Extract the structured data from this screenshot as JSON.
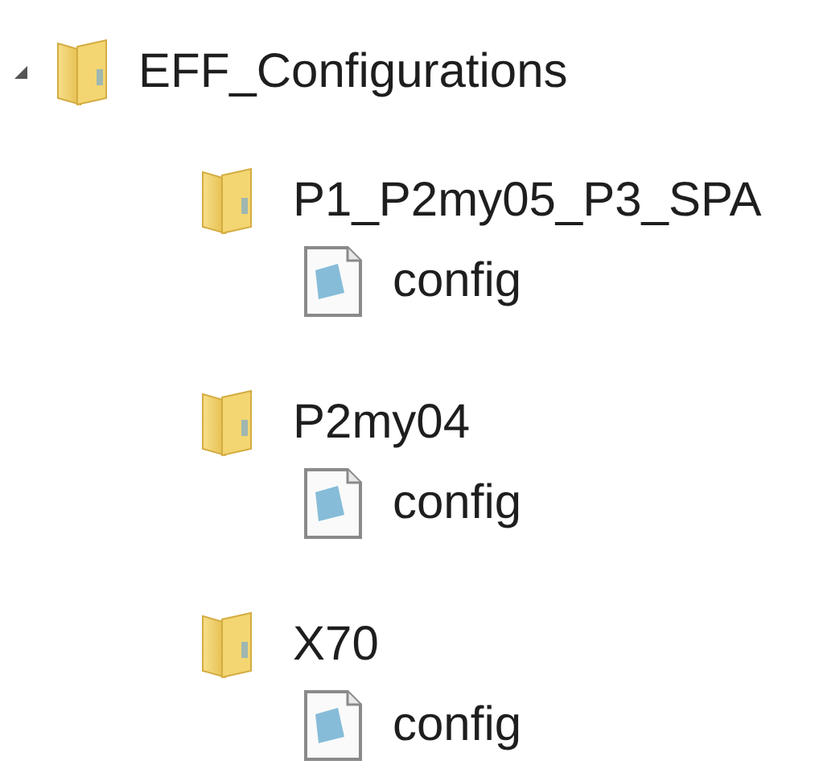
{
  "tree": {
    "label": "EFF_Configurations",
    "kind": "folder",
    "expanded": true,
    "children": [
      {
        "label": "P1_P2my05_P3_SPA",
        "kind": "folder",
        "children": [
          {
            "label": "config",
            "kind": "file"
          }
        ]
      },
      {
        "label": "P2my04",
        "kind": "folder",
        "children": [
          {
            "label": "config",
            "kind": "file"
          }
        ]
      },
      {
        "label": "X70",
        "kind": "folder",
        "children": [
          {
            "label": "config",
            "kind": "file"
          }
        ]
      }
    ]
  }
}
